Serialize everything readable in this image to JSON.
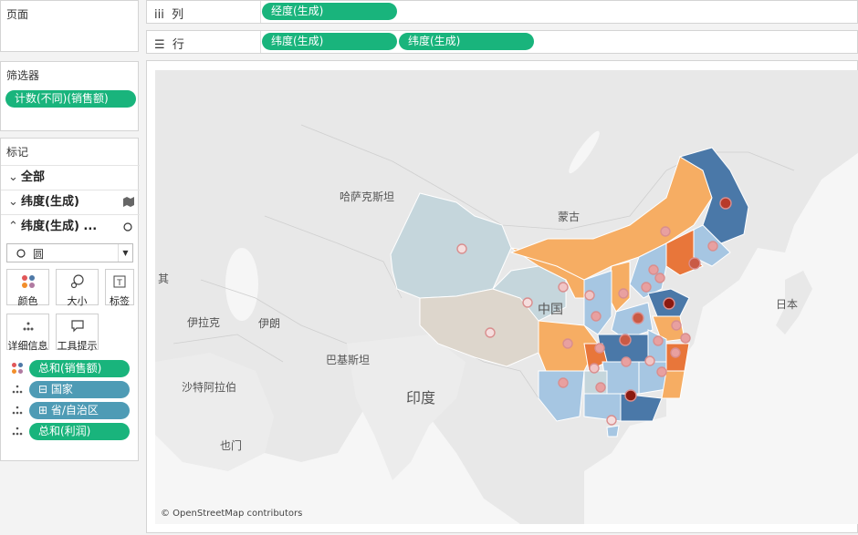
{
  "pages": {
    "title": "页面"
  },
  "columns": {
    "icon": "iii",
    "label": "列",
    "pills": [
      "经度(生成)"
    ]
  },
  "rows": {
    "icon": "☰",
    "label": "行",
    "pills": [
      "纬度(生成)",
      "纬度(生成)"
    ]
  },
  "filters": {
    "title": "筛选器",
    "pills": [
      "计数(不同)(销售额)"
    ]
  },
  "marks": {
    "title": "标记",
    "rows": [
      "全部",
      "纬度(生成)",
      "纬度(生成) ..."
    ],
    "mark_type": "圆",
    "buttons": [
      "颜色",
      "大小",
      "标签",
      "详细信息",
      "工具提示"
    ],
    "fields": [
      "总和(销售额)",
      "国家",
      "省/自治区",
      "总和(利润)"
    ]
  },
  "map": {
    "labels": [
      "哈萨克斯坦",
      "蒙古",
      "中国",
      "伊拉克",
      "伊朗",
      "巴基斯坦",
      "印度",
      "沙特阿拉伯",
      "也门",
      "日本",
      "其"
    ],
    "credit": "© OpenStreetMap contributors",
    "colors": {
      "blue_dark": "#4a78a8",
      "blue_light": "#a6c6e2",
      "orange": "#f6ad63",
      "orange_dark": "#e8763a",
      "grey_blue": "#c5d6dc",
      "beige": "#ddd6cc"
    }
  }
}
